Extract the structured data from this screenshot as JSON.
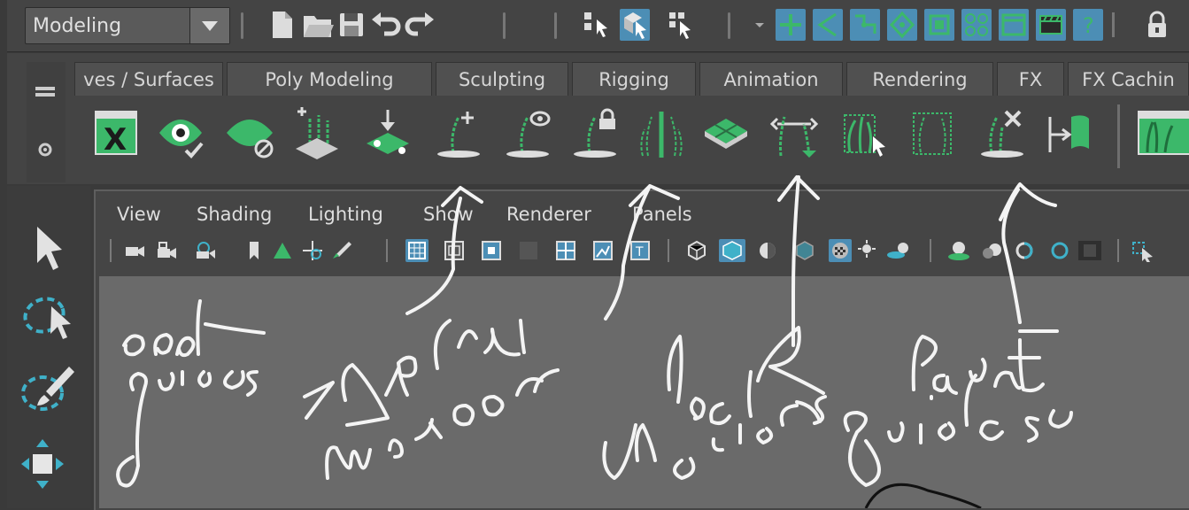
{
  "status_line": {
    "mode": "Modeling"
  },
  "shelf": {
    "tabs": [
      {
        "label": "ves / Surfaces"
      },
      {
        "label": "Poly Modeling"
      },
      {
        "label": "Sculpting"
      },
      {
        "label": "Rigging"
      },
      {
        "label": "Animation"
      },
      {
        "label": "Rendering"
      },
      {
        "label": "FX"
      },
      {
        "label": "FX Cachin"
      }
    ],
    "icons": [
      "xgen-window-icon",
      "visibility-toggle-icon",
      "hide-guides-icon",
      "add-guides-icon",
      "place-guide-icon",
      "add-guide-icon",
      "show-guide-icon",
      "lock-guide-icon",
      "mirror-guides-icon",
      "surface-icon",
      "sculpt-guides-icon",
      "select-guides-icon",
      "guide-frame-icon",
      "delete-guides-icon",
      "paint-guides-icon",
      "grass-preview-icon"
    ]
  },
  "viewport": {
    "menus": [
      "View",
      "Shading",
      "Lighting",
      "Show",
      "Renderer",
      "Panels"
    ]
  },
  "handwritten_notes": [
    {
      "text": "add guides"
    },
    {
      "text": "mirror"
    },
    {
      "text": "unlock guides"
    },
    {
      "text": "paint guides"
    }
  ],
  "colors": {
    "accent_blue": "#4c8eb5",
    "icon_green": "#3cb86a",
    "panel_dark": "#444444",
    "viewport_grey": "#6a6a6a"
  }
}
